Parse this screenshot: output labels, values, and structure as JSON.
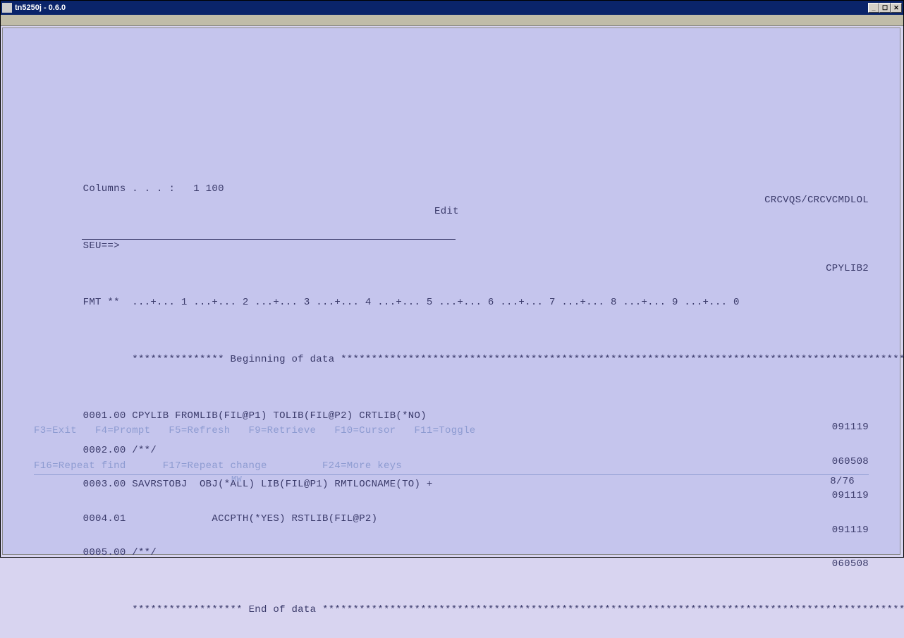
{
  "window": {
    "title": "tn5250j - 0.6.0"
  },
  "header": {
    "columns_label": "Columns . . . :",
    "columns_value": "1 100",
    "mode": "Edit",
    "library_member": "CRCVQS/CRCVCMDLOL",
    "seu_label": "SEU==>",
    "seu_value": "",
    "member_type": "CPYLIB2",
    "fmt_label": "FMT **",
    "ruler": "...+... 1 ...+... 2 ...+... 3 ...+... 4 ...+... 5 ...+... 6 ...+... 7 ...+... 8 ...+... 9 ...+... 0"
  },
  "source": {
    "begin_marker": "*************** Beginning of data ************************************************************************************************",
    "end_marker": "****************** End of data ****************************************************************************************************",
    "lines": [
      {
        "seq": "0001.00",
        "text": "CPYLIB FROMLIB(FIL@P1) TOLIB(FIL@P2) CRTLIB(*NO)",
        "date": "091119"
      },
      {
        "seq": "0002.00",
        "text": "/**/",
        "date": "060508"
      },
      {
        "seq": "0003.00",
        "text": "SAVRSTOBJ  OBJ(*ALL) LIB(FIL@P1) RMTLOCNAME(TO) +",
        "date": "091119"
      },
      {
        "seq": "0004.01",
        "text": "             ACCPTH(*YES) RSTLIB(FIL@P2)",
        "date": "091119"
      },
      {
        "seq": "0005.00",
        "text": "/**/",
        "date": "060508"
      }
    ]
  },
  "fkeys": {
    "row1": "F3=Exit   F4=Prompt   F5=Refresh   F9=Retrieve   F10=Cursor   F11=Toggle",
    "row2": "F16=Repeat find      F17=Repeat change         F24=More keys"
  },
  "status": {
    "indicator": "MW",
    "position": "8/76"
  }
}
